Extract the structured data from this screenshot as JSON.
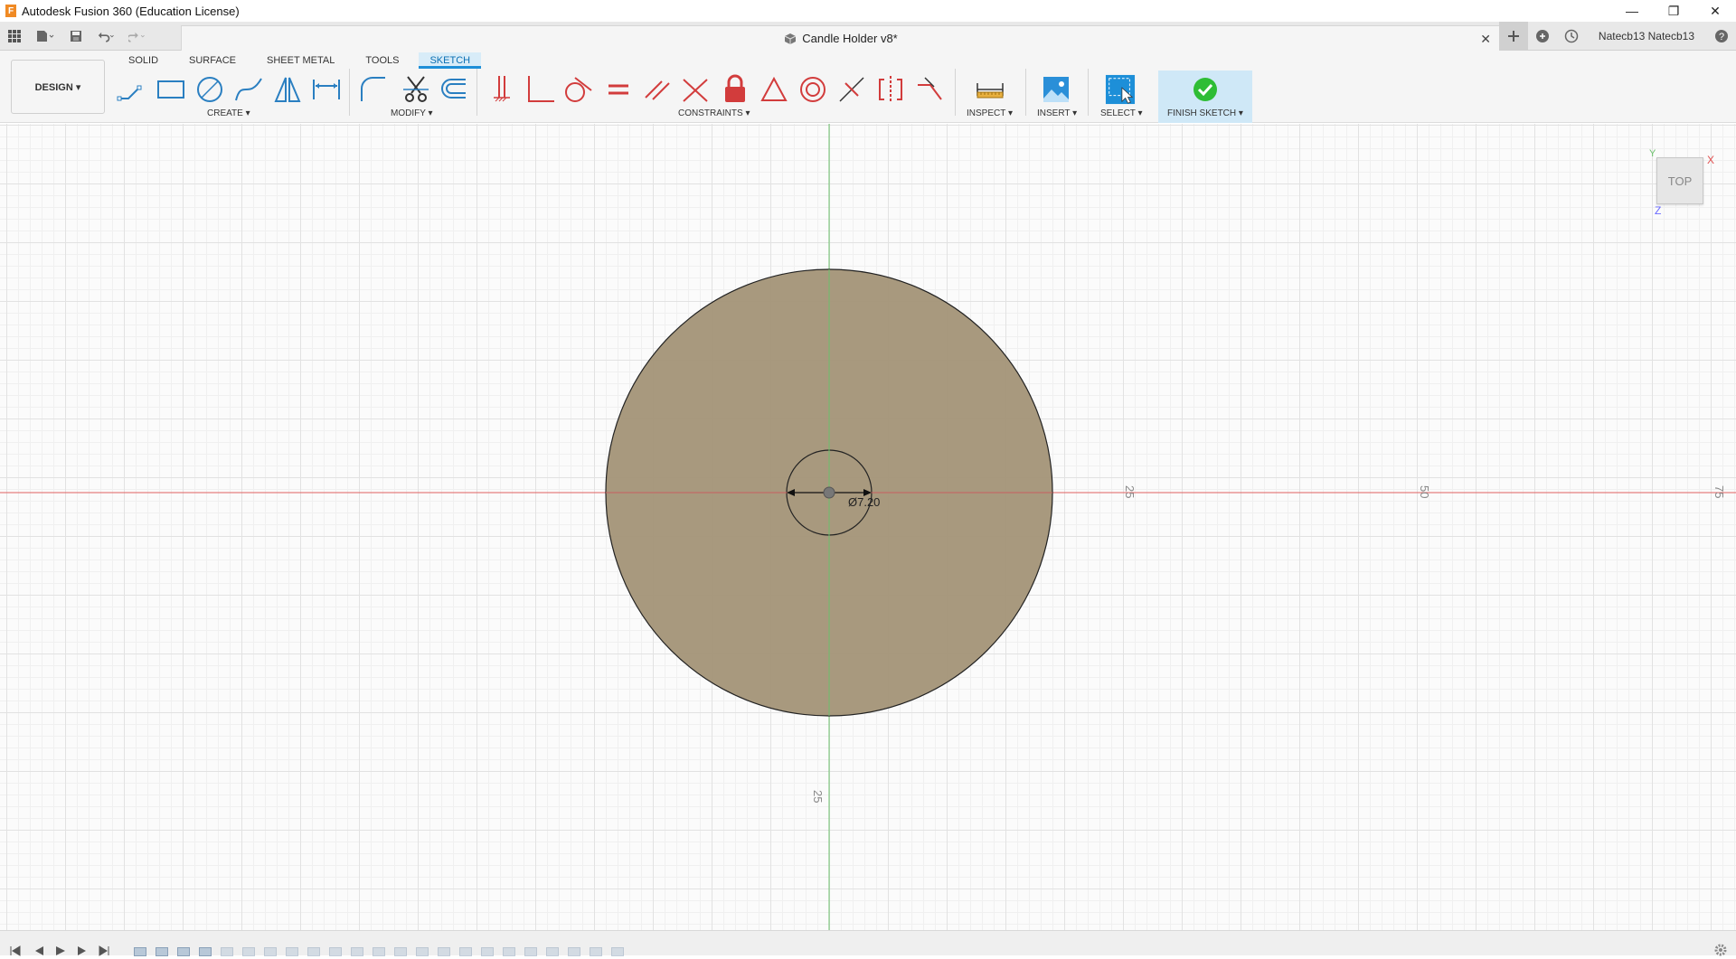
{
  "window": {
    "title": "Autodesk Fusion 360 (Education License)",
    "minimize": "—",
    "maximize": "❐",
    "close": "✕"
  },
  "document": {
    "tab_title": "Candle Holder v8*",
    "close_glyph": "✕"
  },
  "user": {
    "name": "Natecb13 Natecb13"
  },
  "ribbon": {
    "design_label": "DESIGN ▾",
    "tabs": [
      "SOLID",
      "SURFACE",
      "SHEET METAL",
      "TOOLS",
      "SKETCH"
    ],
    "active_tab": "SKETCH",
    "groups": {
      "create": "CREATE ▾",
      "modify": "MODIFY ▾",
      "constraints": "CONSTRAINTS ▾",
      "inspect": "INSPECT ▾",
      "insert": "INSERT ▾",
      "select": "SELECT ▾",
      "finish": "FINISH SKETCH ▾"
    }
  },
  "viewport": {
    "viewcube_label": "TOP",
    "axis_x": "X",
    "axis_y": "Y",
    "axis_z": "Z",
    "dimension_label": "Ø7.20",
    "ruler_labels": [
      "25",
      "50",
      "75",
      "25"
    ]
  },
  "colors": {
    "accent": "#1d8fd8",
    "profile_fill": "#a39477",
    "x_axis": "#e06060",
    "y_axis": "#6cc06c",
    "constraint_red": "#d23c3c",
    "finish_green": "#2ebd35"
  }
}
